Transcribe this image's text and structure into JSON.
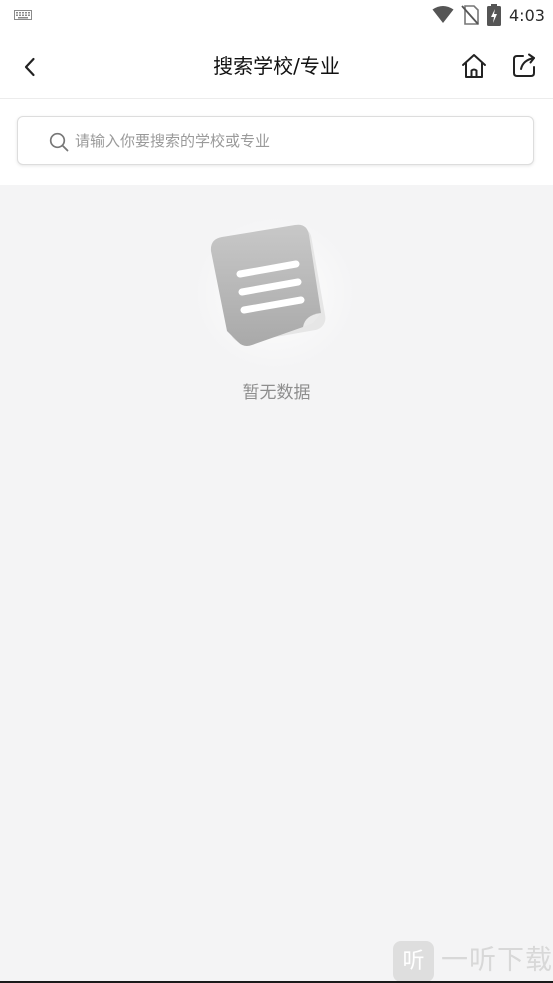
{
  "status_bar": {
    "time": "4:03",
    "icons": [
      "keyboard-icon",
      "wifi-icon",
      "sim-no-signal-icon",
      "battery-charging-icon"
    ]
  },
  "nav": {
    "title": "搜索学校/专业",
    "back_icon": "chevron-left-icon",
    "home_icon": "home-icon",
    "share_icon": "share-icon"
  },
  "search": {
    "placeholder": "请输入你要搜索的学校或专业",
    "value": "",
    "icon": "search-icon"
  },
  "empty_state": {
    "message": "暂无数据",
    "icon": "empty-document-icon"
  },
  "watermark": {
    "badge": "听",
    "text": "一听下载"
  },
  "colors": {
    "background": "#f4f4f5",
    "header": "#ffffff",
    "muted_text": "#8e8e8e",
    "placeholder": "#9a9a9a"
  }
}
